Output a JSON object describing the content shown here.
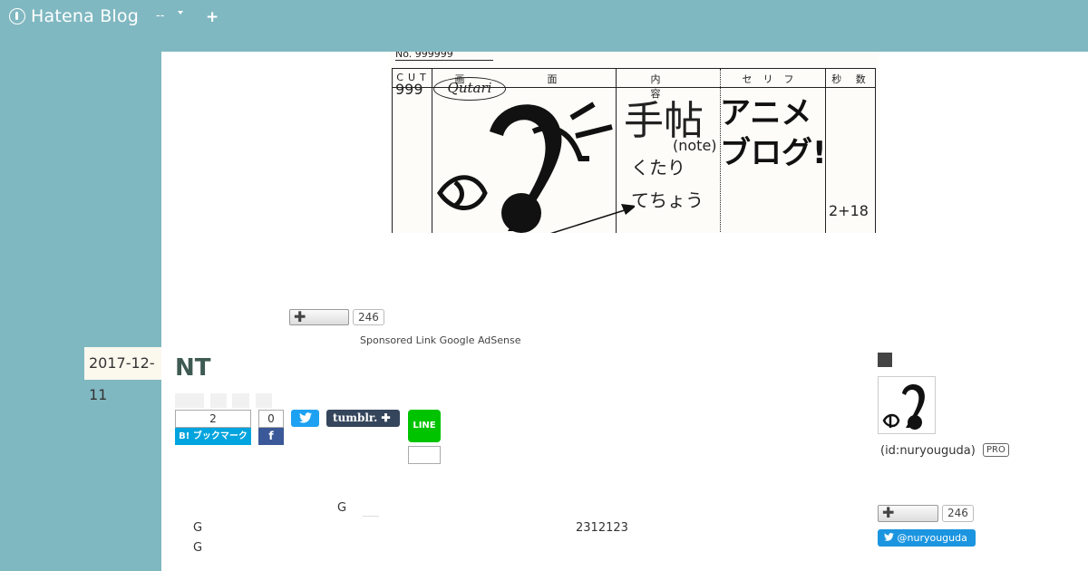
{
  "topbar": {
    "brand": "Hatena Blog",
    "menu_label": "--",
    "plus": "+"
  },
  "header_image": {
    "no": "No. 999999",
    "col_cut": "CUT",
    "col_screen": "画　面",
    "col_content": "内　容",
    "col_serif": "セリフ",
    "col_sec": "秒 数",
    "cut_number": "999",
    "qutari": "Qutari",
    "techo": "手帖",
    "note": "(note)",
    "kutari": "くたり",
    "techou": "てちょう",
    "anime_1": "アニメ",
    "anime_2": "ブログ!",
    "seconds": "2+18"
  },
  "header_star": {
    "count": "246"
  },
  "sponsor": "Sponsored Link Google AdSense",
  "entry": {
    "date_1": "2017-12-",
    "date_2": "11",
    "title": "NT",
    "hatena_bookmark_count": "2",
    "hatena_bookmark_label": "B! ブックマーク",
    "facebook_count": "0",
    "facebook_label": "f",
    "twitter_label": "🐦",
    "tumblr_label": "tumblr.  ✚",
    "line_label": "LINE",
    "text_g1": "G",
    "text_g2": "G",
    "text_g3": "G",
    "text_num": "2312123"
  },
  "sidebar": {
    "user_id": "(id:nuryouguda)",
    "pro_badge": "PRO",
    "star_count": "246",
    "twitter_follow": "@nuryouguda"
  },
  "colors": {
    "background": "#80b8c1",
    "title": "#3e5a52",
    "hatena_blue": "#00a4de",
    "facebook": "#3b5998",
    "twitter": "#1da1f2",
    "tumblr": "#35465c",
    "line": "#00c300"
  }
}
